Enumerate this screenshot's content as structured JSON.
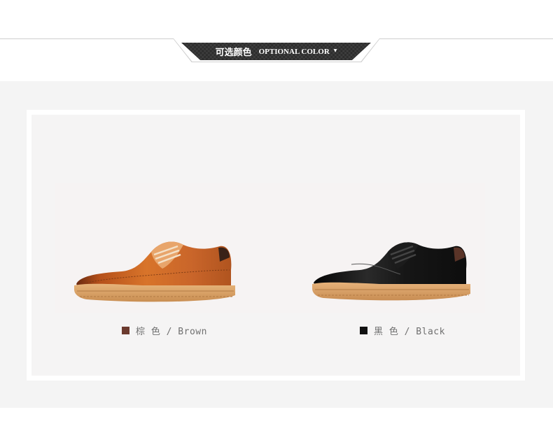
{
  "header": {
    "title_cn": "可选颜色",
    "title_en": "OPTIONAL COLOR",
    "arrow_glyph": "▼"
  },
  "colors": {
    "header_badge": "#2a2a2a",
    "band_background": "#f4f4f4",
    "frame_border": "#ffffff",
    "label_text": "#707070"
  },
  "options": [
    {
      "label": "棕 色 / Brown",
      "swatch_color": "#6b3a2e",
      "image": "brown-brogue-derby-shoe"
    },
    {
      "label": "黑 色 / Black",
      "swatch_color": "#111111",
      "image": "black-brogue-derby-shoe"
    }
  ]
}
